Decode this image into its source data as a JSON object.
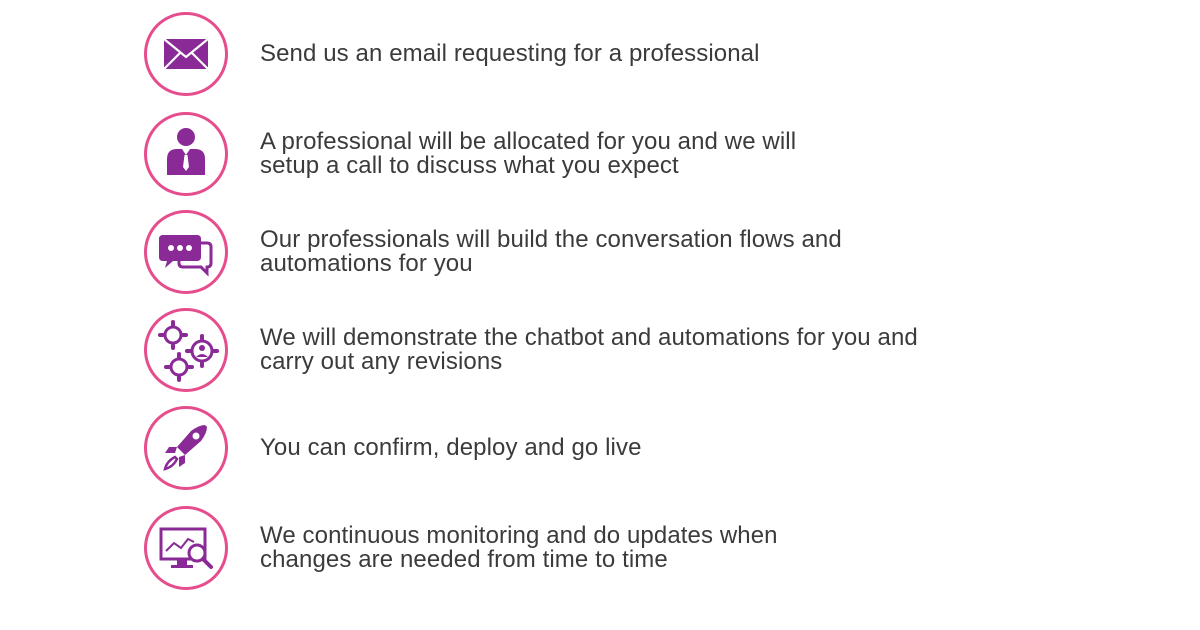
{
  "colors": {
    "ring": "#e64d8d",
    "icon": "#8a2a96",
    "text": "#3b3b3d"
  },
  "steps": [
    {
      "icon": "envelope-icon",
      "text": "Send us an email requesting for a professional"
    },
    {
      "icon": "professional-person-icon",
      "text": "A professional will be allocated for you and we will setup a call to discuss what you expect"
    },
    {
      "icon": "chat-bubbles-icon",
      "text": "Our professionals will build the conversation flows and automations for you"
    },
    {
      "icon": "gears-icon",
      "text": "We will demonstrate the chatbot and automations for you and carry out any revisions"
    },
    {
      "icon": "rocket-icon",
      "text": "You can confirm, deploy and go live"
    },
    {
      "icon": "monitor-magnifier-icon",
      "text": "We continuous monitoring and do updates when changes are needed from time to time"
    }
  ]
}
